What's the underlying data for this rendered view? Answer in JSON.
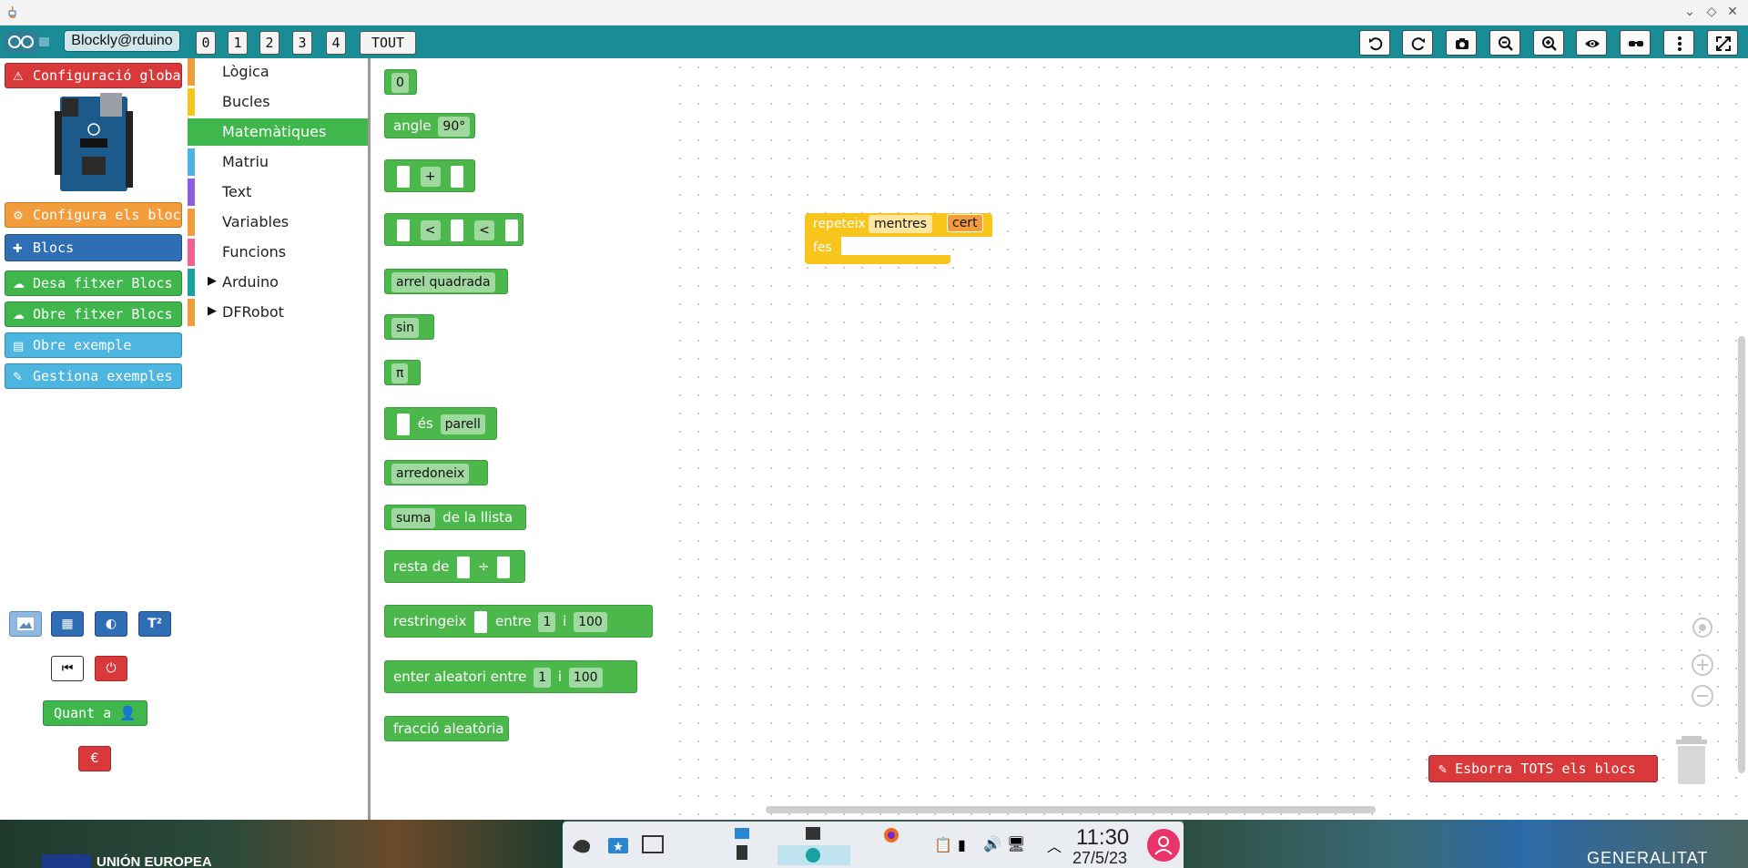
{
  "window": {
    "controls": [
      "⌄",
      "◇",
      "✕"
    ]
  },
  "topbar": {
    "app_name": "Blockly@rduino",
    "levels": [
      "0",
      "1",
      "2",
      "3",
      "4",
      "TOUT"
    ],
    "tools": [
      "undo-icon",
      "redo-icon",
      "camera-icon",
      "zoom-out-icon",
      "zoom-in-icon",
      "eye-icon",
      "glasses-icon",
      "more-vert-icon",
      "fullscreen-icon"
    ]
  },
  "sidebar": {
    "buttons": [
      {
        "label": "Configuració global",
        "icon": "warning-icon",
        "color": "#d9393a"
      },
      {
        "label": "Configura els blocs",
        "icon": "cogs-icon",
        "color": "#f39c3c"
      },
      {
        "label": "Blocs",
        "icon": "puzzle-icon",
        "color": "#2f6db5"
      },
      {
        "label": "Desa fitxer Blocs",
        "icon": "cloud-download-icon",
        "color": "#3fb74c"
      },
      {
        "label": "Obre fitxer Blocs",
        "icon": "cloud-upload-icon",
        "color": "#3fb74c"
      },
      {
        "label": "Obre exemple",
        "icon": "book-icon",
        "color": "#4db6e0"
      },
      {
        "label": "Gestiona exemples",
        "icon": "wrench-icon",
        "color": "#4db6e0"
      }
    ],
    "about_label": "Quant a",
    "euro_label": "€",
    "t2_label": "T²"
  },
  "categories": [
    {
      "label": "Lògica",
      "color": "#f39c3c",
      "arrow": false,
      "selected": false
    },
    {
      "label": "Bucles",
      "color": "#f7c51c",
      "arrow": false,
      "selected": false
    },
    {
      "label": "Matemàtiques",
      "color": "#3fb74c",
      "arrow": false,
      "selected": true
    },
    {
      "label": "Matriu",
      "color": "#4db6e0",
      "arrow": false,
      "selected": false
    },
    {
      "label": "Text",
      "color": "#8e5ee0",
      "arrow": false,
      "selected": false
    },
    {
      "label": "Variables",
      "color": "#f39c3c",
      "arrow": false,
      "selected": false
    },
    {
      "label": "Funcions",
      "color": "#f06292",
      "arrow": false,
      "selected": false
    },
    {
      "label": "Arduino",
      "color": "#16a3a0",
      "arrow": true,
      "selected": false
    },
    {
      "label": "DFRobot",
      "color": "#f39c3c",
      "arrow": true,
      "selected": false
    }
  ],
  "flyout": {
    "b0_value": "0",
    "angle_label": "angle",
    "angle_value": "90°",
    "plus_op": "+",
    "lt_op1": "<",
    "lt_op2": "<",
    "sqrt_label": "arrel quadrada",
    "sin_label": "sin",
    "pi_label": "π",
    "is_label": "és",
    "parity_value": "parell",
    "round_label": "arredoneix",
    "sum_dropdown": "suma",
    "list_label": "de la llista",
    "remainder_label": "resta de",
    "div_symbol": "÷",
    "constrain_label": "restringeix",
    "between_label": "entre",
    "and_label": "i",
    "min_value": "1",
    "max_value": "100",
    "random_label": "enter aleatori entre",
    "random_and": "i",
    "rand_min": "1",
    "rand_max": "100",
    "fraction_label": "fracció aleatòria"
  },
  "workspace": {
    "repeat_label": "repeteix",
    "while_value": "mentres",
    "cond_value": "cert",
    "do_label": "fes",
    "clear_all_label": "Esborra TOTS els blocs"
  },
  "taskbar": {
    "time": "11:30",
    "date": "27/5/23",
    "left_text": "UNIÓN EUROPEA",
    "right_text": "GENERALITAT"
  }
}
